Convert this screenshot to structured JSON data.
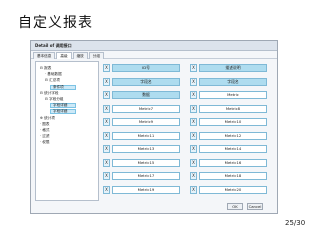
{
  "slide": {
    "title": "自定义报表",
    "page_number": "25/30"
  },
  "dialog": {
    "title": "Detail of 调用接口",
    "tabs": [
      {
        "label": "基本信息",
        "active": false
      },
      {
        "label": "高级",
        "active": true
      },
      {
        "label": "缩放",
        "active": false
      },
      {
        "label": "分组",
        "active": false
      }
    ],
    "tree": [
      {
        "label": "⊟ 报表",
        "level": 0,
        "highlighted": false
      },
      {
        "label": "· 基础数据",
        "level": 1,
        "highlighted": false
      },
      {
        "label": "⊟ 汇总项",
        "level": 1,
        "highlighted": false
      },
      {
        "label": "条件项",
        "level": 2,
        "highlighted": true
      },
      {
        "label": "⊟ 统计字段",
        "level": 0,
        "highlighted": false
      },
      {
        "label": "⊟ 字段分组",
        "level": 1,
        "highlighted": false
      },
      {
        "label": "字段详细",
        "level": 2,
        "highlighted": true
      },
      {
        "label": "字段详细",
        "level": 2,
        "highlighted": true
      },
      {
        "label": "⊕ 统计项",
        "level": 0,
        "highlighted": false
      },
      {
        "label": "· 图表",
        "level": 0,
        "highlighted": false
      },
      {
        "label": "· 格式",
        "level": 0,
        "highlighted": false
      },
      {
        "label": "· 过滤",
        "level": 0,
        "highlighted": false
      },
      {
        "label": "· 权限",
        "level": 0,
        "highlighted": false
      }
    ],
    "grid_rows": [
      [
        {
          "marker": "X",
          "label": "ID号",
          "filled": true
        },
        {
          "marker": "X",
          "label": "描述说明",
          "filled": true
        }
      ],
      [
        {
          "marker": "X",
          "label": "字段名",
          "filled": true
        },
        {
          "marker": "X",
          "label": "字段名",
          "filled": true
        }
      ],
      [
        {
          "marker": "X",
          "label": "数据",
          "filled": true
        },
        {
          "marker": "X",
          "label": "Metric",
          "filled": false
        }
      ],
      [
        {
          "marker": "X",
          "label": "Metric7",
          "filled": false
        },
        {
          "marker": "X",
          "label": "Metric8",
          "filled": false
        }
      ],
      [
        {
          "marker": "X",
          "label": "Metric9",
          "filled": false
        },
        {
          "marker": "X",
          "label": "Metric10",
          "filled": false
        }
      ],
      [
        {
          "marker": "X",
          "label": "Metric11",
          "filled": false
        },
        {
          "marker": "X",
          "label": "Metric12",
          "filled": false
        }
      ],
      [
        {
          "marker": "X",
          "label": "Metric13",
          "filled": false
        },
        {
          "marker": "X",
          "label": "Metric14",
          "filled": false
        }
      ],
      [
        {
          "marker": "X",
          "label": "Metric15",
          "filled": false
        },
        {
          "marker": "X",
          "label": "Metric16",
          "filled": false
        }
      ],
      [
        {
          "marker": "X",
          "label": "Metric17",
          "filled": false
        },
        {
          "marker": "X",
          "label": "Metric18",
          "filled": false
        }
      ],
      [
        {
          "marker": "X",
          "label": "Metric19",
          "filled": false
        },
        {
          "marker": "X",
          "label": "Metric20",
          "filled": false
        }
      ]
    ],
    "buttons": {
      "ok": "OK",
      "cancel": "Cancel"
    }
  }
}
